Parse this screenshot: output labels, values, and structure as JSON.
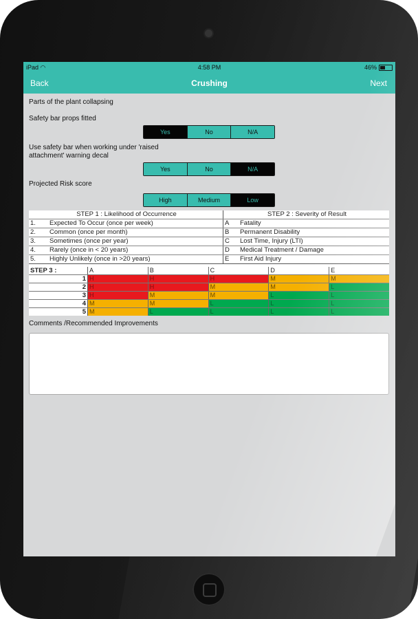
{
  "status": {
    "carrier": "iPad",
    "time": "4:58 PM",
    "battery": "46%"
  },
  "nav": {
    "back": "Back",
    "title": "Crushing",
    "next": "Next"
  },
  "section_heading": "Parts of the plant collapsing",
  "q1": {
    "label": "Safety bar props fitted",
    "options": [
      "Yes",
      "No",
      "N/A"
    ],
    "selected": "Yes"
  },
  "q2": {
    "label_line1": "Use safety bar when working under 'raised",
    "label_line2": "attachment' warning decal",
    "options": [
      "Yes",
      "No",
      "N/A"
    ],
    "selected": "N/A"
  },
  "q3": {
    "label": "Projected Risk score",
    "options": [
      "High",
      "Medium",
      "Low"
    ],
    "selected": "Low"
  },
  "risk_matrix": {
    "step1_title": "STEP 1 : Likelihood of Occurrence",
    "step2_title": "STEP 2 : Severity of Result",
    "likelihood": [
      {
        "n": "1.",
        "text": "Expected To Occur (once per week)"
      },
      {
        "n": "2.",
        "text": "Common (once per month)"
      },
      {
        "n": "3.",
        "text": "Sometimes (once per year)"
      },
      {
        "n": "4.",
        "text": "Rarely (once in < 20 years)"
      },
      {
        "n": "5.",
        "text": "Highly Unlikely (once in >20 years)"
      }
    ],
    "severity": [
      {
        "k": "A",
        "text": "Fatality"
      },
      {
        "k": "B",
        "text": "Permanent Disability"
      },
      {
        "k": "C",
        "text": "Lost Time, Injury (LTI)"
      },
      {
        "k": "D",
        "text": "Medical Treatment / Damage"
      },
      {
        "k": "E",
        "text": "First Aid Injury"
      }
    ],
    "step3_title": "STEP 3 :",
    "columns": [
      "A",
      "B",
      "C",
      "D",
      "E"
    ],
    "rows": [
      {
        "n": "1",
        "cells": [
          "H",
          "H",
          "H",
          "M",
          "M"
        ]
      },
      {
        "n": "2",
        "cells": [
          "H",
          "H",
          "M",
          "M",
          "L"
        ]
      },
      {
        "n": "3",
        "cells": [
          "H",
          "M",
          "M",
          "L",
          "L"
        ]
      },
      {
        "n": "4",
        "cells": [
          "M",
          "M",
          "L",
          "L",
          "L"
        ]
      },
      {
        "n": "5",
        "cells": [
          "M",
          "L",
          "L",
          "L",
          "L"
        ]
      }
    ]
  },
  "comments": {
    "label": "Comments /Recommended Improvements",
    "value": ""
  }
}
